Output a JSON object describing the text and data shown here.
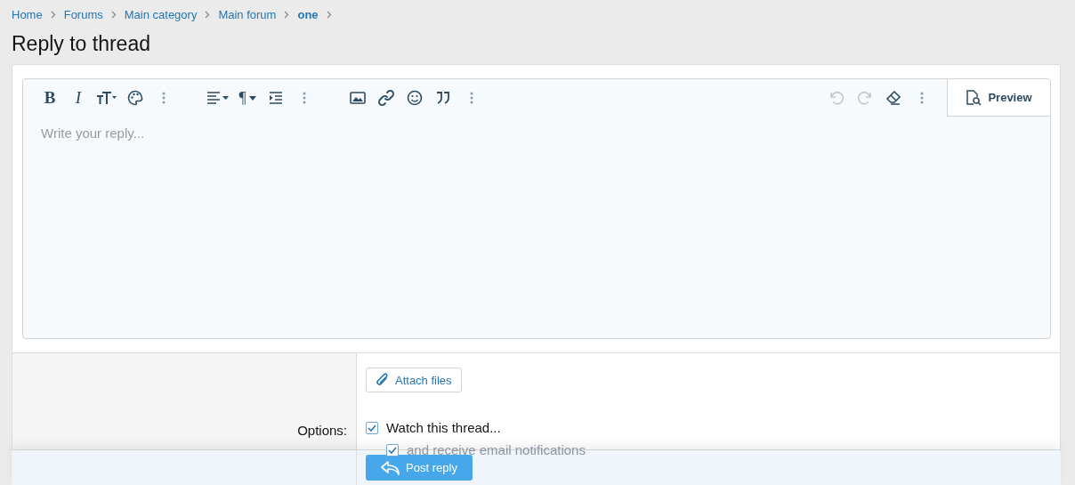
{
  "breadcrumb": [
    {
      "label": "Home",
      "current": false
    },
    {
      "label": "Forums",
      "current": false
    },
    {
      "label": "Main category",
      "current": false
    },
    {
      "label": "Main forum",
      "current": false
    },
    {
      "label": "one",
      "current": true
    }
  ],
  "title": "Reply to thread",
  "toolbar": {
    "groups": [
      [
        {
          "kind": "bold",
          "glyph": "B"
        },
        {
          "kind": "italic",
          "glyph": "I"
        },
        {
          "kind": "textsize"
        },
        {
          "kind": "palette"
        },
        {
          "kind": "more"
        }
      ],
      [
        {
          "kind": "align"
        },
        {
          "kind": "paragraph",
          "glyph": "¶"
        },
        {
          "kind": "indent"
        },
        {
          "kind": "more"
        }
      ],
      [
        {
          "kind": "image"
        },
        {
          "kind": "link"
        },
        {
          "kind": "smile"
        },
        {
          "kind": "quote"
        },
        {
          "kind": "more"
        }
      ]
    ],
    "right": [
      {
        "kind": "undo",
        "disabled": true
      },
      {
        "kind": "redo",
        "disabled": true
      },
      {
        "kind": "eraser",
        "disabled": false
      },
      {
        "kind": "more",
        "disabled": false
      }
    ],
    "preview": "Preview"
  },
  "editor": {
    "placeholder": "Write your reply..."
  },
  "attach": "Attach files",
  "options_label": "Options:",
  "options": [
    {
      "label": "Watch this thread...",
      "checked": true,
      "faded": false
    },
    {
      "label": "and receive email notifications",
      "checked": true,
      "faded": true
    }
  ],
  "submit": "Post reply"
}
